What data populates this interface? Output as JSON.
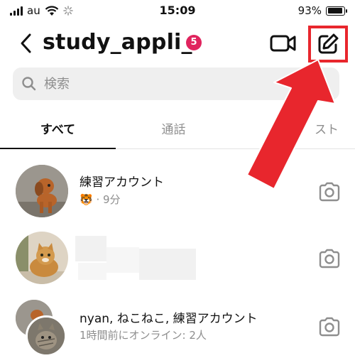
{
  "status_bar": {
    "carrier": "au",
    "time": "15:09",
    "battery": "93%",
    "battery_level": 0.93
  },
  "header": {
    "back_icon": "chevron-left-icon",
    "title": "study_appli_",
    "badge": "5",
    "video_icon": "video-camera-icon",
    "compose_icon": "compose-icon"
  },
  "search": {
    "placeholder": "検索",
    "icon": "search-icon"
  },
  "tabs": [
    {
      "label": "すべて",
      "active": true
    },
    {
      "label": "通話",
      "active": false
    },
    {
      "label": "スト",
      "active": false
    }
  ],
  "conversations": [
    {
      "name": "練習アカウント",
      "emoji": "🐯",
      "subtitle": "· 9分",
      "camera_icon": "camera-icon"
    },
    {
      "name": "",
      "subtitle": "",
      "camera_icon": "camera-icon"
    },
    {
      "name": "nyan, ねこねこ, 練習アカウント",
      "subtitle": "1時間前にオンライン: 2人",
      "camera_icon": "camera-icon"
    }
  ],
  "annotation": {
    "highlight_color": "#e8262d"
  }
}
